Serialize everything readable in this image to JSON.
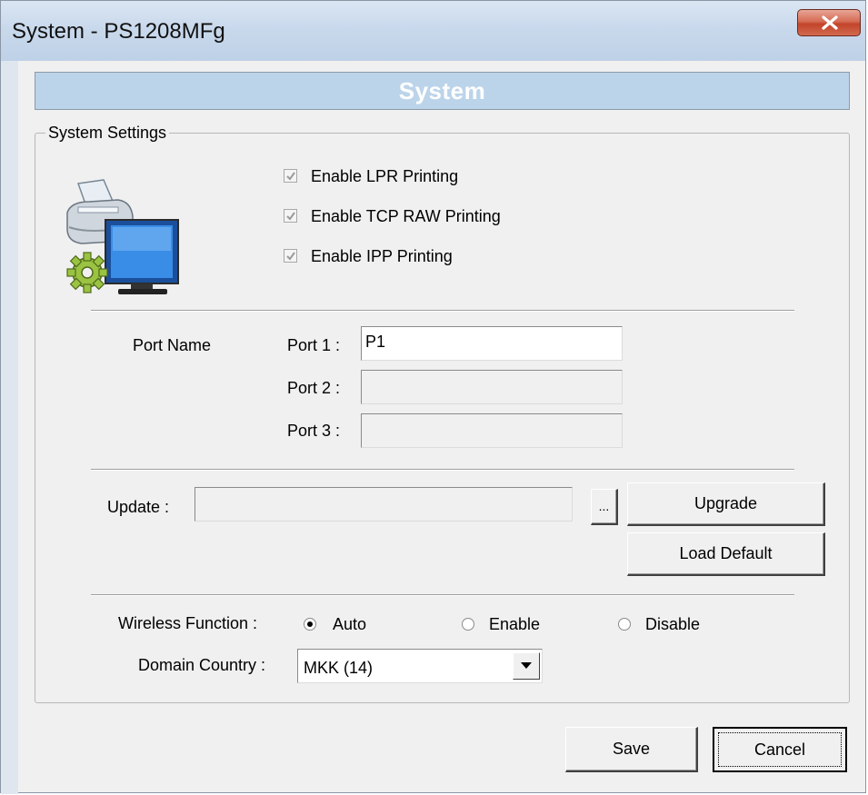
{
  "window": {
    "title": "System - PS1208MFg",
    "close_icon": "close-x-icon"
  },
  "header": {
    "title": "System"
  },
  "settings": {
    "group_label": "System Settings",
    "icon": "printer-computer-gear-icon",
    "checkboxes": [
      {
        "label": "Enable LPR Printing",
        "checked": true,
        "disabled": true
      },
      {
        "label": "Enable TCP RAW Printing",
        "checked": true,
        "disabled": true
      },
      {
        "label": "Enable IPP Printing",
        "checked": true,
        "disabled": true
      }
    ]
  },
  "ports": {
    "section_label": "Port Name",
    "items": [
      {
        "label": "Port 1 :",
        "value": "P1",
        "enabled": true
      },
      {
        "label": "Port 2 :",
        "value": "",
        "enabled": false
      },
      {
        "label": "Port 3 :",
        "value": "",
        "enabled": false
      }
    ]
  },
  "update": {
    "label": "Update :",
    "value": "",
    "browse_label": "...",
    "upgrade_label": "Upgrade",
    "load_default_label": "Load Default"
  },
  "wireless": {
    "label": "Wireless Function :",
    "options": [
      {
        "label": "Auto",
        "selected": true
      },
      {
        "label": "Enable",
        "selected": false
      },
      {
        "label": "Disable",
        "selected": false
      }
    ]
  },
  "domain": {
    "label": "Domain Country :",
    "selected": "MKK (14)"
  },
  "footer": {
    "save_label": "Save",
    "cancel_label": "Cancel"
  },
  "colors": {
    "header_bar": "#bcd4ea",
    "title_bar": "#c9d9ec",
    "close_button": "#c2442a"
  }
}
